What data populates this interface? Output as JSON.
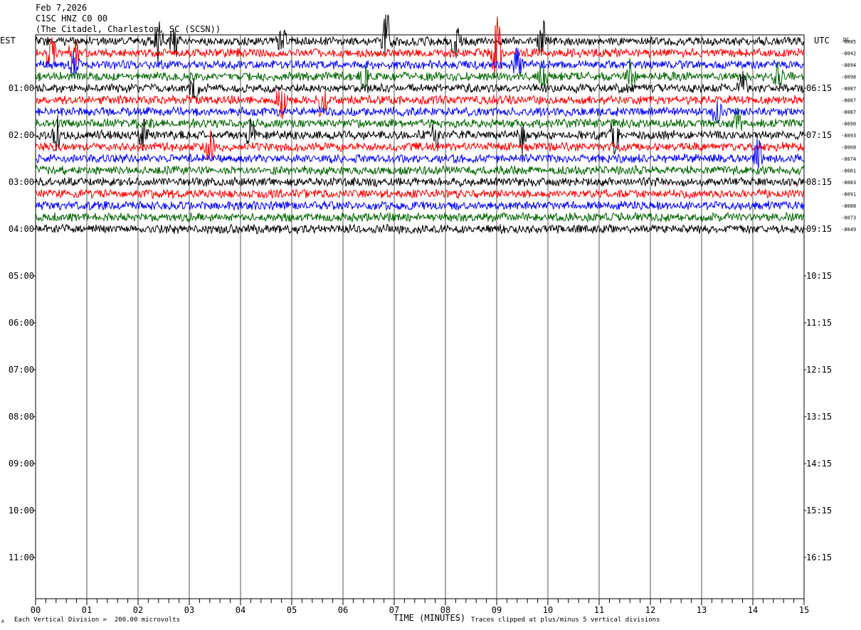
{
  "header": {
    "date": "Feb 7,2026",
    "channel": "C1SC HNZ C0 00",
    "station": "(The Citadel, Charleston, SC (SCSN))"
  },
  "left_tz": "EST",
  "right_tz": "UTC",
  "dc_label": "DC",
  "footer": {
    "scale": "Each Vertical Division =  200.00 microvolts",
    "xaxis_title": "TIME (MINUTES)",
    "clip": "Traces clipped at plus/minus 5 vertical divisions",
    "corner_mark": "A"
  },
  "chart_data": {
    "type": "line",
    "title": "",
    "xlabel": "TIME (MINUTES)",
    "ylabel": "",
    "xlim": [
      0,
      15
    ],
    "x_ticks": [
      "00",
      "01",
      "02",
      "03",
      "04",
      "05",
      "06",
      "07",
      "08",
      "09",
      "10",
      "11",
      "12",
      "13",
      "14",
      "15"
    ],
    "left_hour_labels": [
      "01:00",
      "02:00",
      "03:00",
      "04:00",
      "05:00",
      "06:00",
      "07:00",
      "08:00",
      "09:00",
      "10:00",
      "11:00"
    ],
    "right_hour_labels": [
      "06:15",
      "07:15",
      "08:15",
      "09:15",
      "10:15",
      "11:15",
      "12:15",
      "13:15",
      "14:15",
      "15:15",
      "16:15"
    ],
    "rows_per_hour": 4,
    "trace_colors": [
      "#000000",
      "#ff0000",
      "#0000ff",
      "#006400"
    ],
    "dc_offsets": [
      "-8085",
      "-8042",
      "-8094",
      "-8098",
      "-8087",
      "-8087",
      "-8087",
      "-8090",
      "-8093",
      "-8068",
      "-8074",
      "-8081",
      "-8083",
      "-8091",
      "-8088",
      "-8073",
      "-8049"
    ],
    "events": [
      {
        "row": 0,
        "minute": 2.4,
        "amp": 2.0
      },
      {
        "row": 0,
        "minute": 2.7,
        "amp": 2.2
      },
      {
        "row": 0,
        "minute": 4.8,
        "amp": 1.5
      },
      {
        "row": 0,
        "minute": 6.85,
        "amp": 3.0
      },
      {
        "row": 0,
        "minute": 8.2,
        "amp": 2.0
      },
      {
        "row": 0,
        "minute": 9.9,
        "amp": 2.0
      },
      {
        "row": 1,
        "minute": 0.3,
        "amp": 2.0
      },
      {
        "row": 1,
        "minute": 0.75,
        "amp": 1.5
      },
      {
        "row": 1,
        "minute": 9.0,
        "amp": 4.0
      },
      {
        "row": 2,
        "minute": 0.75,
        "amp": 1.3
      },
      {
        "row": 2,
        "minute": 9.4,
        "amp": 1.5
      },
      {
        "row": 3,
        "minute": 6.4,
        "amp": 1.5
      },
      {
        "row": 3,
        "minute": 9.9,
        "amp": 1.5
      },
      {
        "row": 3,
        "minute": 11.6,
        "amp": 1.5
      },
      {
        "row": 3,
        "minute": 14.5,
        "amp": 1.5
      },
      {
        "row": 4,
        "minute": 3.1,
        "amp": 1.2
      },
      {
        "row": 4,
        "minute": 13.8,
        "amp": 1.5
      },
      {
        "row": 5,
        "minute": 4.8,
        "amp": 2.0
      },
      {
        "row": 5,
        "minute": 5.6,
        "amp": 2.5
      },
      {
        "row": 6,
        "minute": 13.3,
        "amp": 1.5
      },
      {
        "row": 7,
        "minute": 13.7,
        "amp": 1.3
      },
      {
        "row": 8,
        "minute": 0.4,
        "amp": 2.0
      },
      {
        "row": 8,
        "minute": 2.1,
        "amp": 1.5
      },
      {
        "row": 8,
        "minute": 4.2,
        "amp": 1.5
      },
      {
        "row": 8,
        "minute": 7.8,
        "amp": 1.5
      },
      {
        "row": 8,
        "minute": 9.5,
        "amp": 1.5
      },
      {
        "row": 8,
        "minute": 11.3,
        "amp": 1.5
      },
      {
        "row": 9,
        "minute": 3.4,
        "amp": 1.5
      },
      {
        "row": 10,
        "minute": 14.1,
        "amp": 2.0
      }
    ]
  }
}
